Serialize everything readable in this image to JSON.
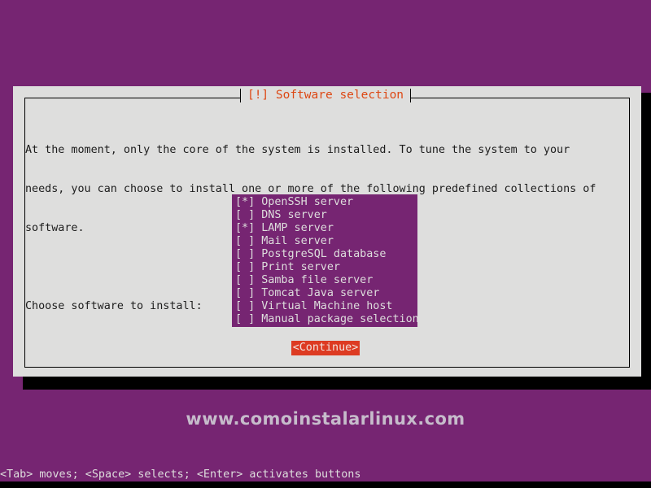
{
  "colors": {
    "desktop_background": "#762572",
    "dialog_background": "#dededd",
    "dialog_border": "#000000",
    "title_accent": "#dd4814",
    "button_background": "#dd3b22",
    "button_text": "#f2e3de",
    "list_background": "#762572",
    "list_text": "#dededd",
    "shadow": "#000000",
    "watermark_text": "#c6bccb"
  },
  "dialog": {
    "title": "[!] Software selection",
    "body_paragraph_lines": [
      "At the moment, only the core of the system is installed. To tune the system to your",
      "needs, you can choose to install one or more of the following predefined collections of",
      "software."
    ],
    "prompt": "Choose software to install:",
    "list": {
      "items": [
        {
          "marker": "[*]",
          "label": "OpenSSH server",
          "checked": true,
          "text": "[*] OpenSSH server"
        },
        {
          "marker": "[ ]",
          "label": "DNS server",
          "checked": false,
          "text": "[ ] DNS server"
        },
        {
          "marker": "[*]",
          "label": "LAMP server",
          "checked": true,
          "text": "[*] LAMP server"
        },
        {
          "marker": "[ ]",
          "label": "Mail server",
          "checked": false,
          "text": "[ ] Mail server"
        },
        {
          "marker": "[ ]",
          "label": "PostgreSQL database",
          "checked": false,
          "text": "[ ] PostgreSQL database"
        },
        {
          "marker": "[ ]",
          "label": "Print server",
          "checked": false,
          "text": "[ ] Print server"
        },
        {
          "marker": "[ ]",
          "label": "Samba file server",
          "checked": false,
          "text": "[ ] Samba file server"
        },
        {
          "marker": "[ ]",
          "label": "Tomcat Java server",
          "checked": false,
          "text": "[ ] Tomcat Java server"
        },
        {
          "marker": "[ ]",
          "label": "Virtual Machine host",
          "checked": false,
          "text": "[ ] Virtual Machine host"
        },
        {
          "marker": "[ ]",
          "label": "Manual package selection",
          "checked": false,
          "text": "[ ] Manual package selection"
        }
      ]
    },
    "continue_button": "<Continue>"
  },
  "watermark": "www.comoinstalarlinux.com",
  "statusline": "<Tab> moves; <Space> selects; <Enter> activates buttons"
}
